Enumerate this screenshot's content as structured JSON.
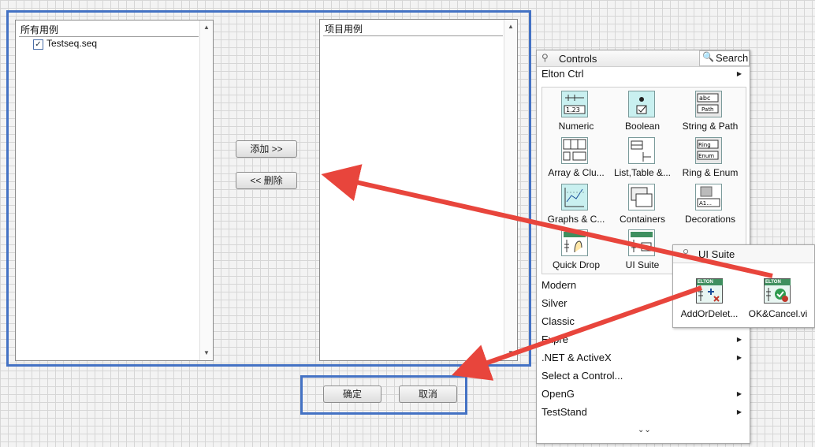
{
  "left_panel": {
    "all_cases_header": "所有用例",
    "all_cases_items": [
      {
        "label": "Testseq.seq",
        "checked": true
      }
    ],
    "project_cases_header": "项目用例",
    "add_label": "添加 >>",
    "delete_label": "<< 删除"
  },
  "bottom_buttons": {
    "ok_label": "确定",
    "cancel_label": "取消"
  },
  "palette": {
    "title": "Controls",
    "search_label": "Search",
    "current_category": "Elton Ctrl",
    "tiles": [
      {
        "label": "Numeric",
        "icon": "numeric-icon"
      },
      {
        "label": "Boolean",
        "icon": "boolean-icon"
      },
      {
        "label": "String & Path",
        "icon": "string-path-icon"
      },
      {
        "label": "Array & Clu...",
        "icon": "array-cluster-icon"
      },
      {
        "label": "List,Table &...",
        "icon": "list-table-icon"
      },
      {
        "label": "Ring & Enum",
        "icon": "ring-enum-icon"
      },
      {
        "label": "Graphs & C...",
        "icon": "graphs-icon"
      },
      {
        "label": "Containers",
        "icon": "containers-icon"
      },
      {
        "label": "Decorations",
        "icon": "decorations-icon"
      },
      {
        "label": "Quick Drop",
        "icon": "quick-drop-icon"
      },
      {
        "label": "UI Suite",
        "icon": "ui-suite-icon"
      }
    ],
    "menu": [
      {
        "label": "Modern",
        "submenu": false
      },
      {
        "label": "Silver",
        "submenu": false
      },
      {
        "label": "Classic",
        "submenu": false
      },
      {
        "label": "Expre",
        "submenu": true
      },
      {
        "label": ".NET & ActiveX",
        "submenu": true
      },
      {
        "label": "Select a Control...",
        "submenu": false
      },
      {
        "label": "OpenG",
        "submenu": true
      },
      {
        "label": "TestStand",
        "submenu": true
      }
    ],
    "icon_text": {
      "numeric": "1.23",
      "string": "abc",
      "path": "Path",
      "ring": "Ring",
      "enum": "Enum",
      "decor": "A1..."
    }
  },
  "ui_suite_popup": {
    "title": "UI Suite",
    "items": [
      {
        "label": "AddOrDelet...",
        "badge": "ELTON",
        "icon": "add-or-delete-icon"
      },
      {
        "label": "OK&Cancel.vi",
        "badge": "ELTON",
        "icon": "ok-cancel-icon"
      }
    ]
  },
  "colors": {
    "highlight_border": "#4472c4",
    "arrow": "#e8453c",
    "icon_fill": "#c9f0f0"
  }
}
